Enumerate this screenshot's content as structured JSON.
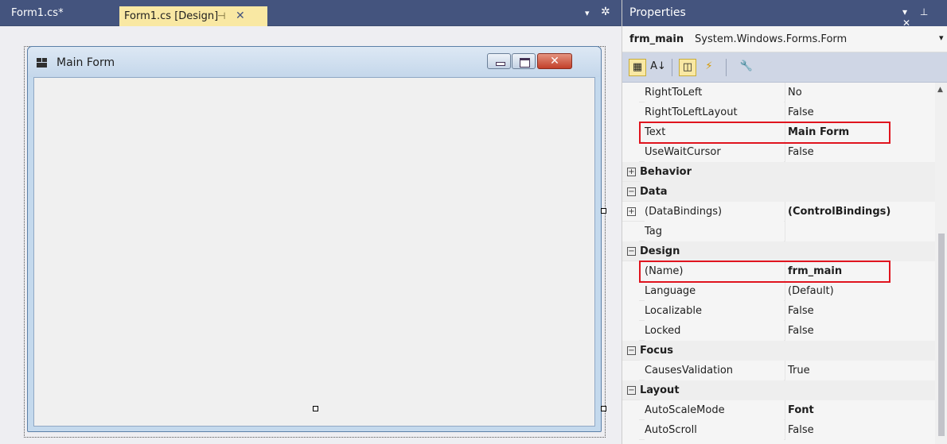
{
  "editor": {
    "tabs": [
      {
        "label": "Form1.cs*"
      },
      {
        "label": "Form1.cs [Design]",
        "pin": "⊣",
        "close": "✕"
      }
    ],
    "menu_glyph": "▾",
    "gear_glyph": "✲"
  },
  "form": {
    "title": "Main Form",
    "close_glyph": "✕"
  },
  "properties": {
    "title": "Properties",
    "header_icons": "▾ ⊥ ✕",
    "object_name": "frm_main",
    "object_type": "System.Windows.Forms.Form",
    "dropdown_glyph": "▾",
    "toolbar": {
      "categorized": "▦",
      "alphabetical": "A↓",
      "properties": "◫",
      "events": "⚡",
      "property_pages": "🔧"
    },
    "rows": [
      {
        "name": "RightToLeft",
        "value": "No"
      },
      {
        "name": "RightToLeftLayout",
        "value": "False"
      },
      {
        "name": "Text",
        "value": "Main Form"
      },
      {
        "name": "UseWaitCursor",
        "value": "False"
      },
      {
        "name": "Behavior"
      },
      {
        "name": "Data"
      },
      {
        "name": "(DataBindings)",
        "value": "(ControlBindings)"
      },
      {
        "name": "Tag",
        "value": ""
      },
      {
        "name": "Design"
      },
      {
        "name": "(Name)",
        "value": "frm_main"
      },
      {
        "name": "Language",
        "value": "(Default)"
      },
      {
        "name": "Localizable",
        "value": "False"
      },
      {
        "name": "Locked",
        "value": "False"
      },
      {
        "name": "Focus"
      },
      {
        "name": "CausesValidation",
        "value": "True"
      },
      {
        "name": "Layout"
      },
      {
        "name": "AutoScaleMode",
        "value": "Font"
      },
      {
        "name": "AutoScroll",
        "value": "False"
      }
    ],
    "expanders": {
      "plus": "+",
      "minus": "−"
    },
    "scroll_up": "▲"
  }
}
